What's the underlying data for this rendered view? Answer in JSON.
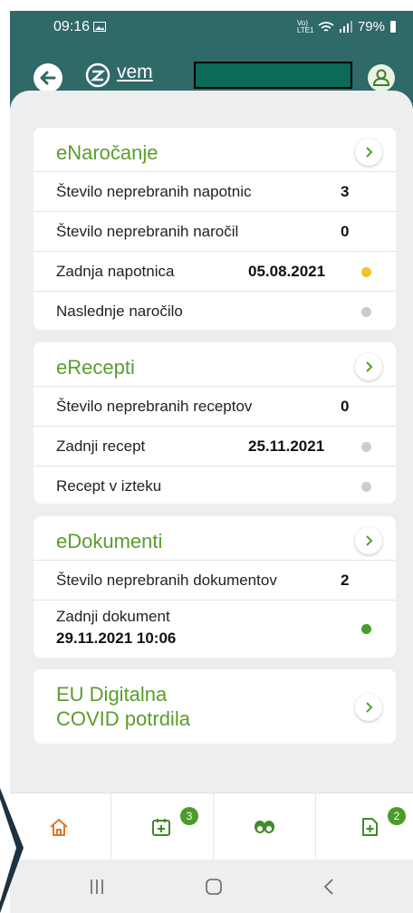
{
  "status": {
    "time": "09:16",
    "net": "Vo) LTE1",
    "battery": "79%"
  },
  "header": {
    "logo_text": "vem"
  },
  "enarocanje": {
    "title": "eNaročanje",
    "rows": [
      {
        "label": "Število neprebranih napotnic",
        "value": "3"
      },
      {
        "label": "Število neprebranih naročil",
        "value": "0"
      },
      {
        "label": "Zadnja napotnica",
        "value": "05.08.2021",
        "dot": "#f2c42c"
      },
      {
        "label": "Naslednje naročilo",
        "value": "",
        "dot": "#cccccc"
      }
    ]
  },
  "erecepti": {
    "title": "eRecepti",
    "rows": [
      {
        "label": "Število neprebranih receptov",
        "value": "0"
      },
      {
        "label": "Zadnji recept",
        "value": "25.11.2021",
        "dot": "#cccccc"
      },
      {
        "label": "Recept v izteku",
        "value": "",
        "dot": "#cccccc"
      }
    ]
  },
  "edokumenti": {
    "title": "eDokumenti",
    "rows": [
      {
        "label": "Število neprebranih dokumentov",
        "value": "2"
      },
      {
        "label": "Zadnji dokument",
        "value": "29.11.2021 10:06",
        "dot": "#4c9b2b"
      }
    ]
  },
  "covid": {
    "title_line1": "EU Digitalna",
    "title_line2": "COVID potrdila"
  },
  "bottom_nav": {
    "items": [
      {
        "icon": "home-icon"
      },
      {
        "icon": "calendar-plus-icon",
        "badge": "3"
      },
      {
        "icon": "pills-icon"
      },
      {
        "icon": "document-plus-icon",
        "badge": "2"
      }
    ]
  },
  "colors": {
    "accent": "#5a9d2d",
    "header": "#2f6968",
    "badge": "#4c9b2b"
  }
}
